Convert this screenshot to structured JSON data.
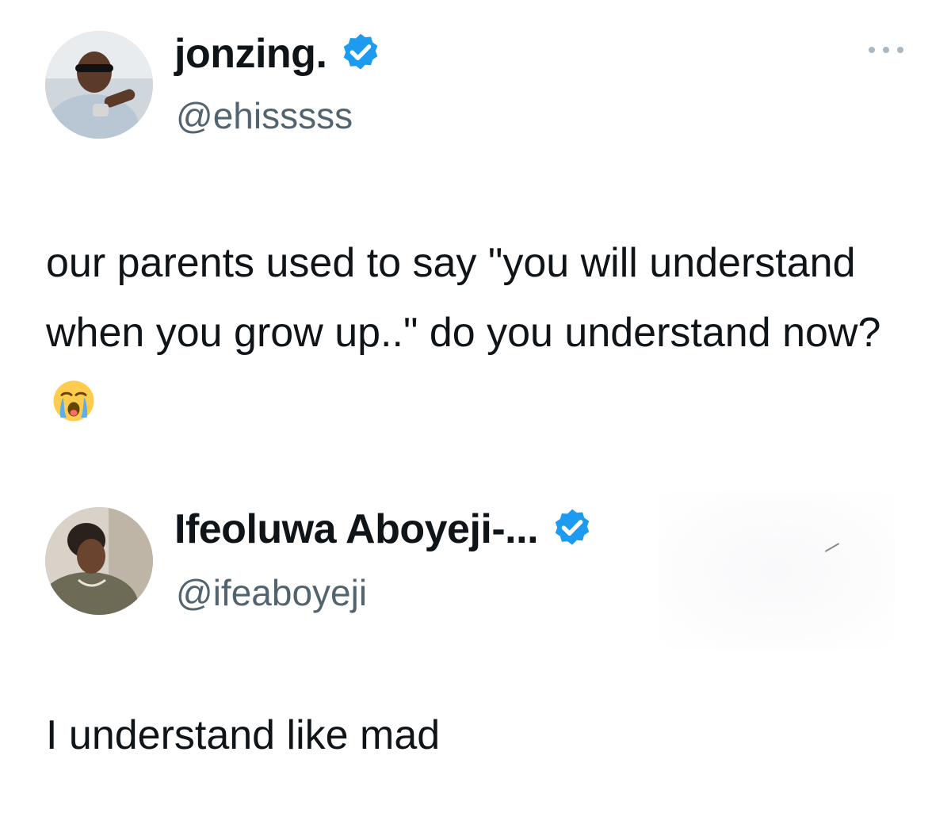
{
  "tweets": [
    {
      "display_name": "jonzing.",
      "handle": "@ehisssss",
      "text": "our parents used to say \"you will understand when you grow up..\" do you understand now?",
      "emoji": "loudly-crying-face-icon",
      "verified": true,
      "more_icon": "more-options-icon"
    },
    {
      "display_name": "Ifeoluwa Aboyeji-...",
      "handle": "@ifeaboyeji",
      "text": "I understand like mad",
      "verified": true
    }
  ],
  "colors": {
    "text": "#0f1419",
    "secondary": "#536471",
    "verified_badge": "#1d9bf0",
    "background": "#ffffff"
  }
}
